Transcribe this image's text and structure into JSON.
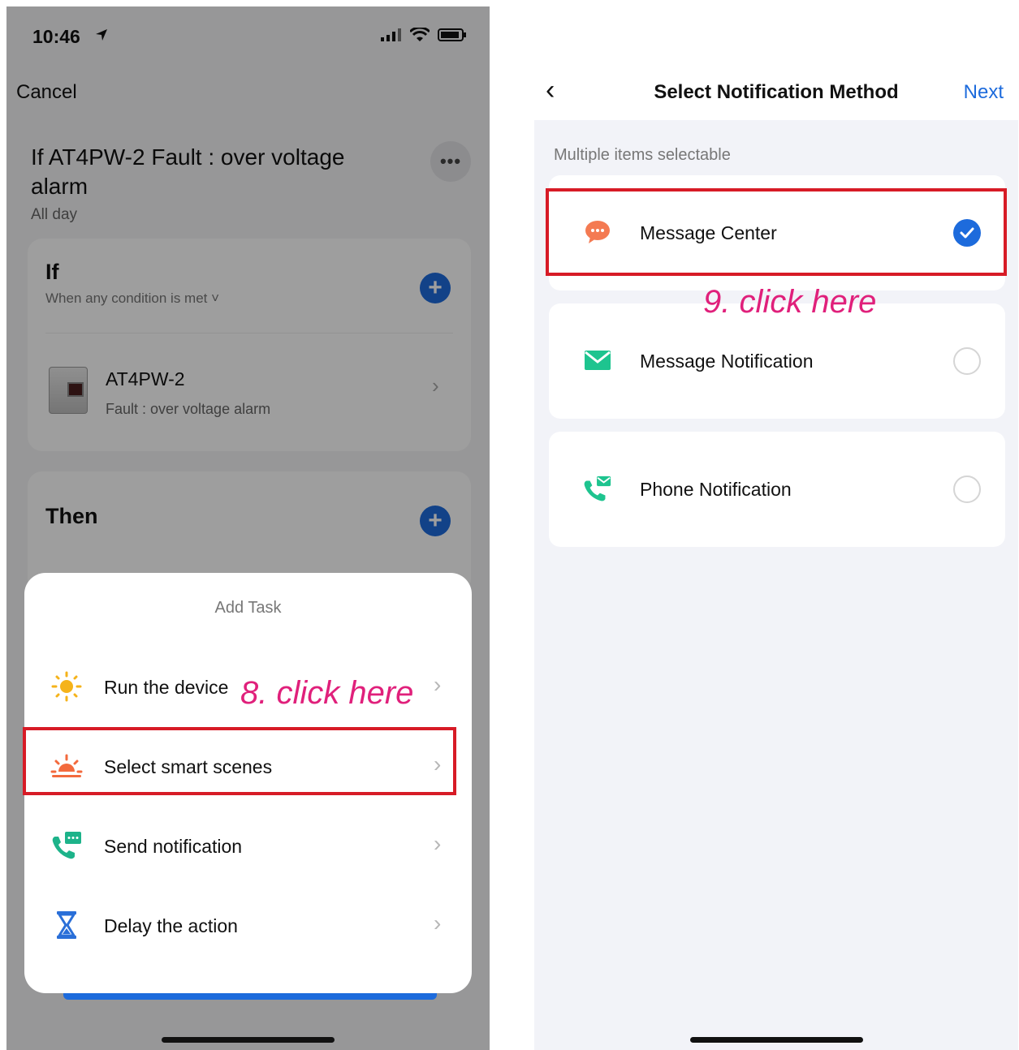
{
  "left": {
    "status_time": "10:46",
    "cancel_label": "Cancel",
    "rule_title": "If AT4PW-2 Fault : over voltage alarm",
    "rule_schedule": "All day",
    "more_label": "•••",
    "if_card": {
      "heading": "If",
      "condition": "When any condition is met ˅",
      "device_name": "AT4PW-2",
      "device_state": "Fault : over voltage alarm"
    },
    "then_card": {
      "heading": "Then"
    },
    "sheet": {
      "title": "Add Task",
      "items": [
        {
          "label": "Run the device",
          "icon": "sun-icon"
        },
        {
          "label": "Select smart scenes",
          "icon": "sunrise-icon"
        },
        {
          "label": "Send notification",
          "icon": "phone-message-icon"
        },
        {
          "label": "Delay the action",
          "icon": "hourglass-icon"
        }
      ]
    },
    "annotation": "8. click here"
  },
  "right": {
    "nav_title": "Select Notification Method",
    "next_label": "Next",
    "multi_label": "Multiple items selectable",
    "options": [
      {
        "label": "Message Center",
        "icon": "chat-bubble-icon",
        "selected": true
      },
      {
        "label": "Message Notification",
        "icon": "envelope-icon",
        "selected": false
      },
      {
        "label": "Phone Notification",
        "icon": "phone-mail-icon",
        "selected": false
      }
    ],
    "annotation": "9. click here"
  },
  "colors": {
    "accent": "#1d6bdc",
    "highlight_box": "#d71b26",
    "annotation_text": "#e0207b"
  }
}
